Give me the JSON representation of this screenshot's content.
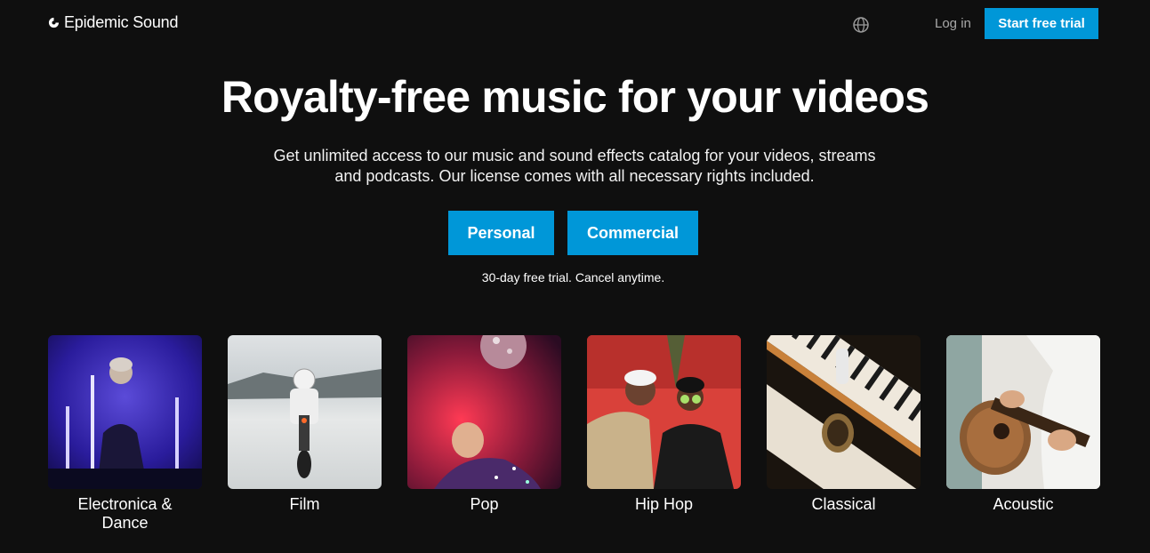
{
  "header": {
    "logo_text": "Epidemic Sound",
    "language_icon": "globe-icon",
    "login_label": "Log in",
    "cta_label": "Start free trial"
  },
  "hero": {
    "title": "Royalty-free music for your videos",
    "subtitle": "Get unlimited access to our music and sound effects catalog for your videos, streams and podcasts. Our license comes with all necessary rights included.",
    "buttons": [
      "Personal",
      "Commercial"
    ],
    "note": "30-day free trial. Cancel anytime."
  },
  "genres": [
    {
      "label": "Electronica & Dance"
    },
    {
      "label": "Film"
    },
    {
      "label": "Pop"
    },
    {
      "label": "Hip Hop"
    },
    {
      "label": "Classical"
    },
    {
      "label": "Acoustic"
    }
  ],
  "colors": {
    "background": "#0f0f0f",
    "accent": "#0097d8",
    "muted_text": "#a9a9a9"
  }
}
